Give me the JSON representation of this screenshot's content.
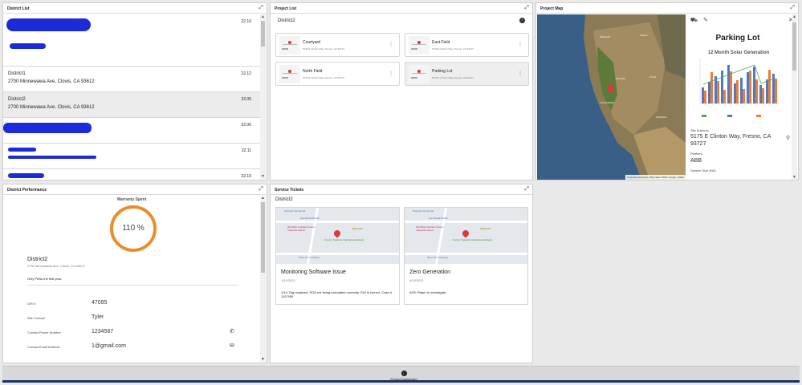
{
  "district_list": {
    "title": "District List",
    "rows": [
      {
        "name": "",
        "address": "",
        "date": "22.10",
        "redacted": true
      },
      {
        "name": "District1",
        "address": "2700 Minnewawa Ave, Clovis, CA 93612",
        "date": "22.12",
        "redacted": false
      },
      {
        "name": "District2",
        "address": "2700 Minnewawa Ave, Clovis, CA 93612",
        "date": "22.05",
        "redacted": false
      },
      {
        "name": "",
        "address": "",
        "date": "22.06",
        "redacted": true
      },
      {
        "name": "",
        "address": "",
        "date": "22.11",
        "redacted": true
      },
      {
        "name": "",
        "address": "",
        "date": "22.10",
        "redacted": true
      }
    ]
  },
  "project_list": {
    "title": "Project List",
    "district": "District2",
    "cards": [
      {
        "title": "Courtyard",
        "address": "5175 E Clinton Way, Fresno, CA 93727"
      },
      {
        "title": "East Field",
        "address": "5175 E Clinton Way, Fresno, CA 93727"
      },
      {
        "title": "North Field",
        "address": "5175 E Clinton Way, Fresno, CA 93727"
      },
      {
        "title": "Parking Lot",
        "address": "5175 E Clinton Way, Fresno, CA 93727"
      }
    ]
  },
  "project_map": {
    "title": "Project Map",
    "attribution": "Keyboard shortcuts | Map data ©2021 Google, INEGI",
    "labels": [
      "OREGON",
      "IDAHO",
      "NEVADA",
      "UTAH",
      "CALIFORNIA",
      "ARIZONA"
    ],
    "detail": {
      "title": "Parking Lot",
      "chart_title": "12 Month Solar Generation",
      "site_address_label": "Site Address",
      "site_address": "5175 E Clinton Way, Fresno, CA 93727",
      "platform_label": "Platform",
      "platform": "ABB",
      "system_size_label": "System Size (kW)"
    }
  },
  "district_performance": {
    "title": "District Performance",
    "gauge_title": "Warranty Spent",
    "gauge_value": "110 %",
    "gauge_fraction": 1.1,
    "district_name": "District2",
    "district_address": "2700 Minnewawa Ave, Clovis, CA 93612",
    "note": "Only PeBu the first year.",
    "fields": [
      {
        "label": "DIR #",
        "value": "47095",
        "icon": ""
      },
      {
        "label": "Site Contact",
        "value": "Tyler",
        "icon": ""
      },
      {
        "label": "Contact Phone Number",
        "value": "1234567",
        "icon": "phone-icon"
      },
      {
        "label": "Contact Email Address",
        "value": "1@gmail.com",
        "icon": "email-icon"
      }
    ]
  },
  "service_tickets": {
    "title": "Service Tickets",
    "district": "District2",
    "map_labels": [
      "National Car Rental",
      "Car Rental Return",
      "Wyndham Garden Fresno Yosemite Airport",
      "Starbucks",
      "Fresno Yosemite International Airport",
      "Short Term Parking"
    ],
    "tickets": [
      {
        "title": "Monitoring Software Issue",
        "date": "1/14/2021",
        "note": "1/14: Digi replaced. PGA not being calculated correctly, GHI is correct. Case # 1107909"
      },
      {
        "title": "Zero Generation",
        "date": "4/19/2021",
        "note": "4/26: Ralph to investigate."
      }
    ]
  },
  "dock": {
    "tab_label": "Project Dashboard"
  },
  "colors": {
    "accent": "#ec8d2c",
    "redaction": "#1c2bd8",
    "dock": "#1a2f6b"
  }
}
